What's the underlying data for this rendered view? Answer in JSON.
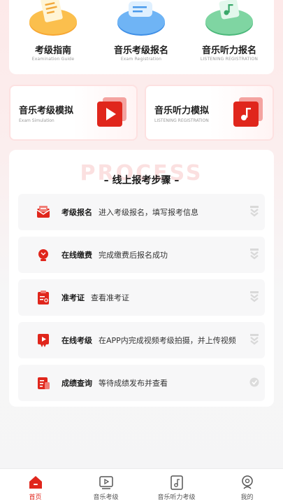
{
  "quick_links": [
    {
      "title": "考级指南",
      "subtitle": "Examination Guide",
      "icon": "document-icon"
    },
    {
      "title": "音乐考级报名",
      "subtitle": "Exam Registration",
      "icon": "chat-bubble-icon"
    },
    {
      "title": "音乐听力报名",
      "subtitle": "LISTENING REGISTRATION",
      "icon": "music-note-icon"
    }
  ],
  "simulations": [
    {
      "title": "音乐考级模拟",
      "subtitle": "Exam Simulation",
      "icon": "video-play-icon"
    },
    {
      "title": "音乐听力模拟",
      "subtitle": "LISTENING REGISTRATION",
      "icon": "music-card-icon"
    }
  ],
  "process": {
    "watermark": "PROCESS",
    "title": "– 线上报考步骤 –",
    "steps": [
      {
        "name": "考级报名",
        "desc": "进入考级报名，填写报考信息",
        "icon": "mail-form-icon"
      },
      {
        "name": "在线缴费",
        "desc": "完成缴费后报名成功",
        "icon": "coin-icon"
      },
      {
        "name": "准考证",
        "desc": "查看准考证",
        "icon": "admission-ticket-icon"
      },
      {
        "name": "在线考级",
        "desc": "在APP内完成视频考级拍摄，并上传视频",
        "icon": "video-badge-icon"
      },
      {
        "name": "成绩查询",
        "desc": "等待成绩发布并查看",
        "icon": "report-icon"
      }
    ]
  },
  "tabbar": [
    {
      "label": "首页",
      "icon": "home-icon",
      "active": true
    },
    {
      "label": "音乐考级",
      "icon": "video-play-icon",
      "active": false
    },
    {
      "label": "音乐听力考级",
      "icon": "music-file-icon",
      "active": false
    },
    {
      "label": "我的",
      "icon": "profile-icon",
      "active": false
    }
  ],
  "colors": {
    "accent": "#e0261c",
    "accent_light": "#fde9e9"
  }
}
